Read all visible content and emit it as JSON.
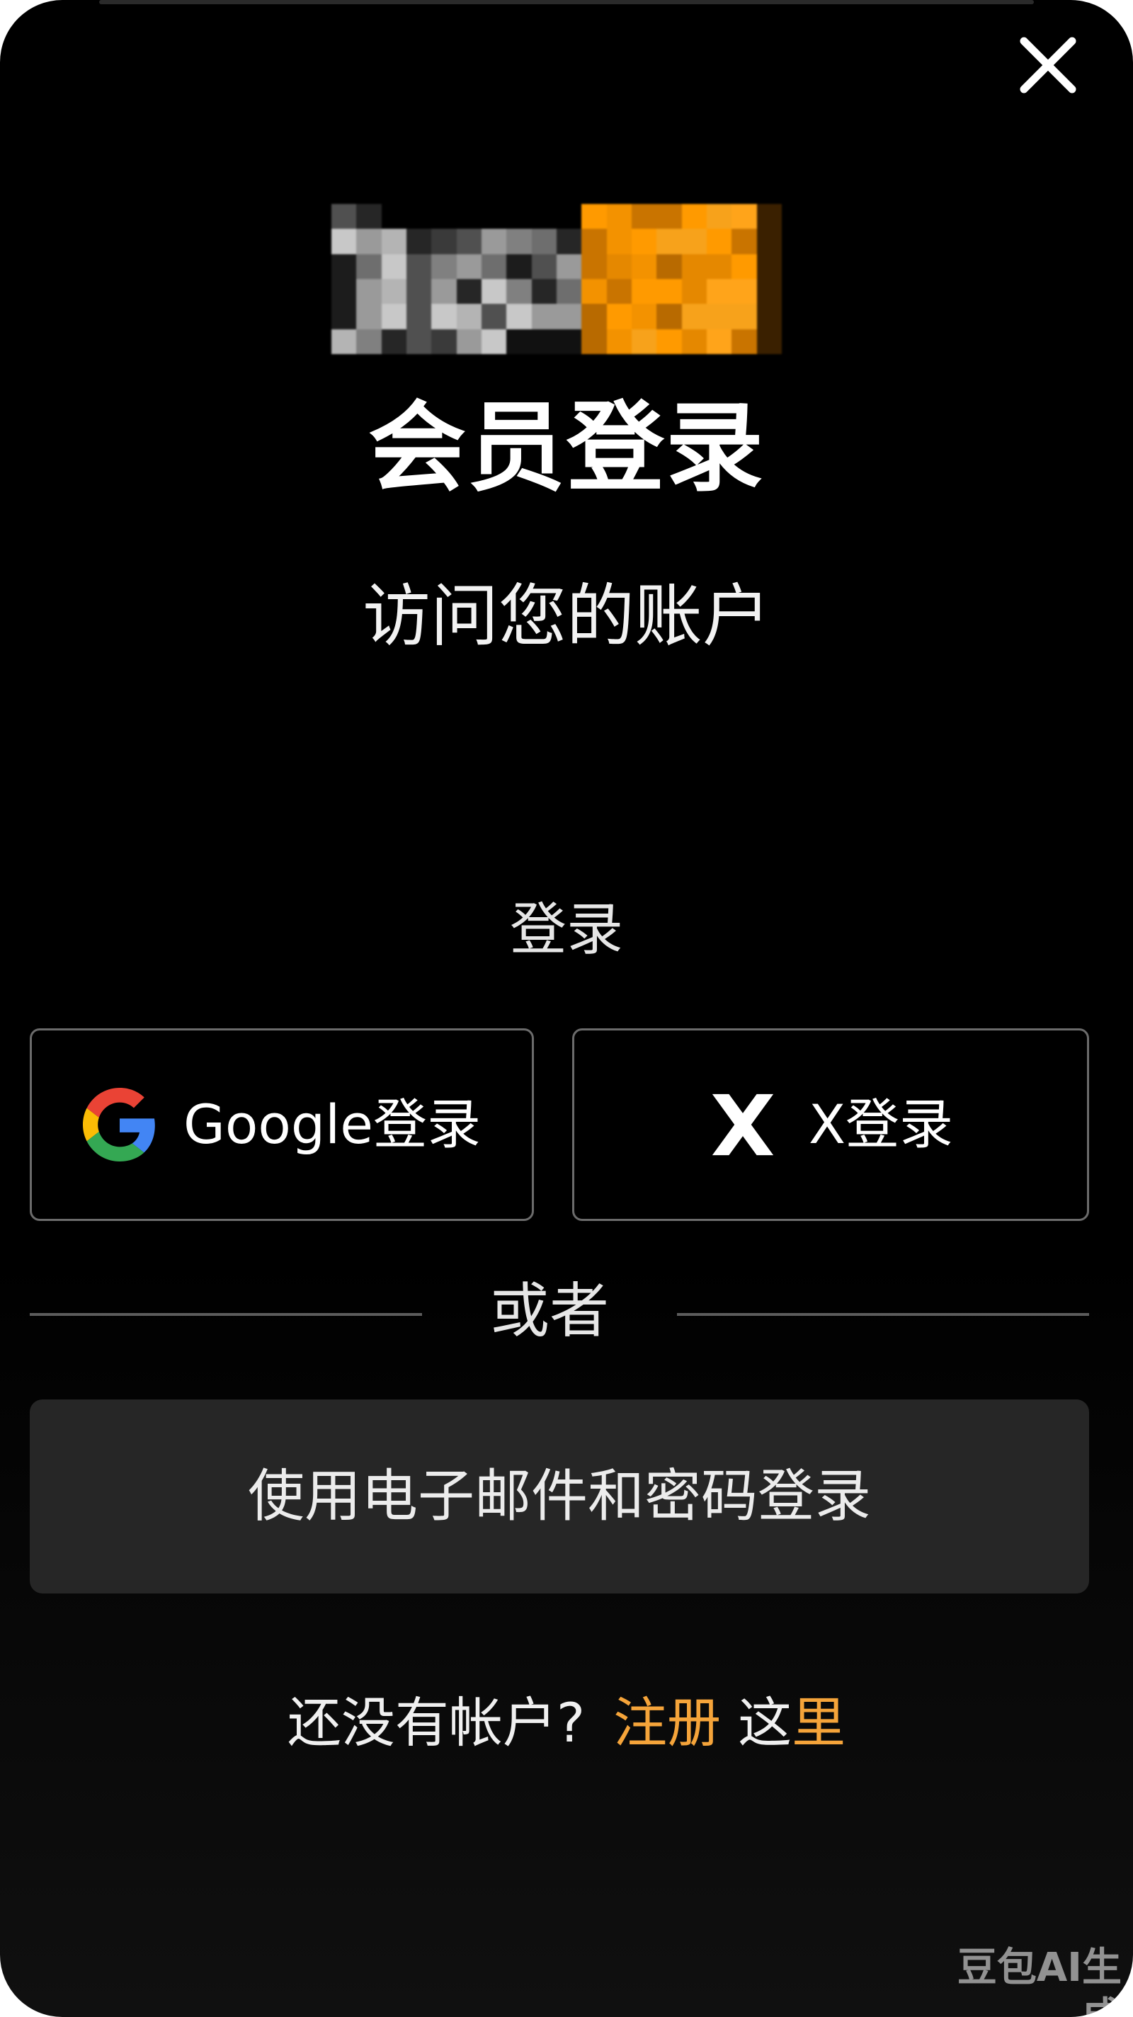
{
  "dialog": {
    "title": "会员登录",
    "subtitle": "访问您的账户",
    "close_icon": "close-icon"
  },
  "login": {
    "section_label": "登录",
    "google_button_label": "Google登录",
    "google_icon": "google-icon",
    "x_button_label": "X登录",
    "x_icon": "x-icon",
    "divider_label": "或者",
    "email_button_label": "使用电子邮件和密码登录"
  },
  "signup": {
    "prompt": "还没有帐户?",
    "link_label": "注册",
    "here_prefix": "这",
    "here_suffix": "里"
  },
  "watermark": {
    "text": "豆包AI生成"
  },
  "colors": {
    "background": "#000000",
    "accent": "#f5a43a",
    "logo_orange": "#ff9a00",
    "email_button_bg": "#262626",
    "border": "#6b6b6b"
  }
}
